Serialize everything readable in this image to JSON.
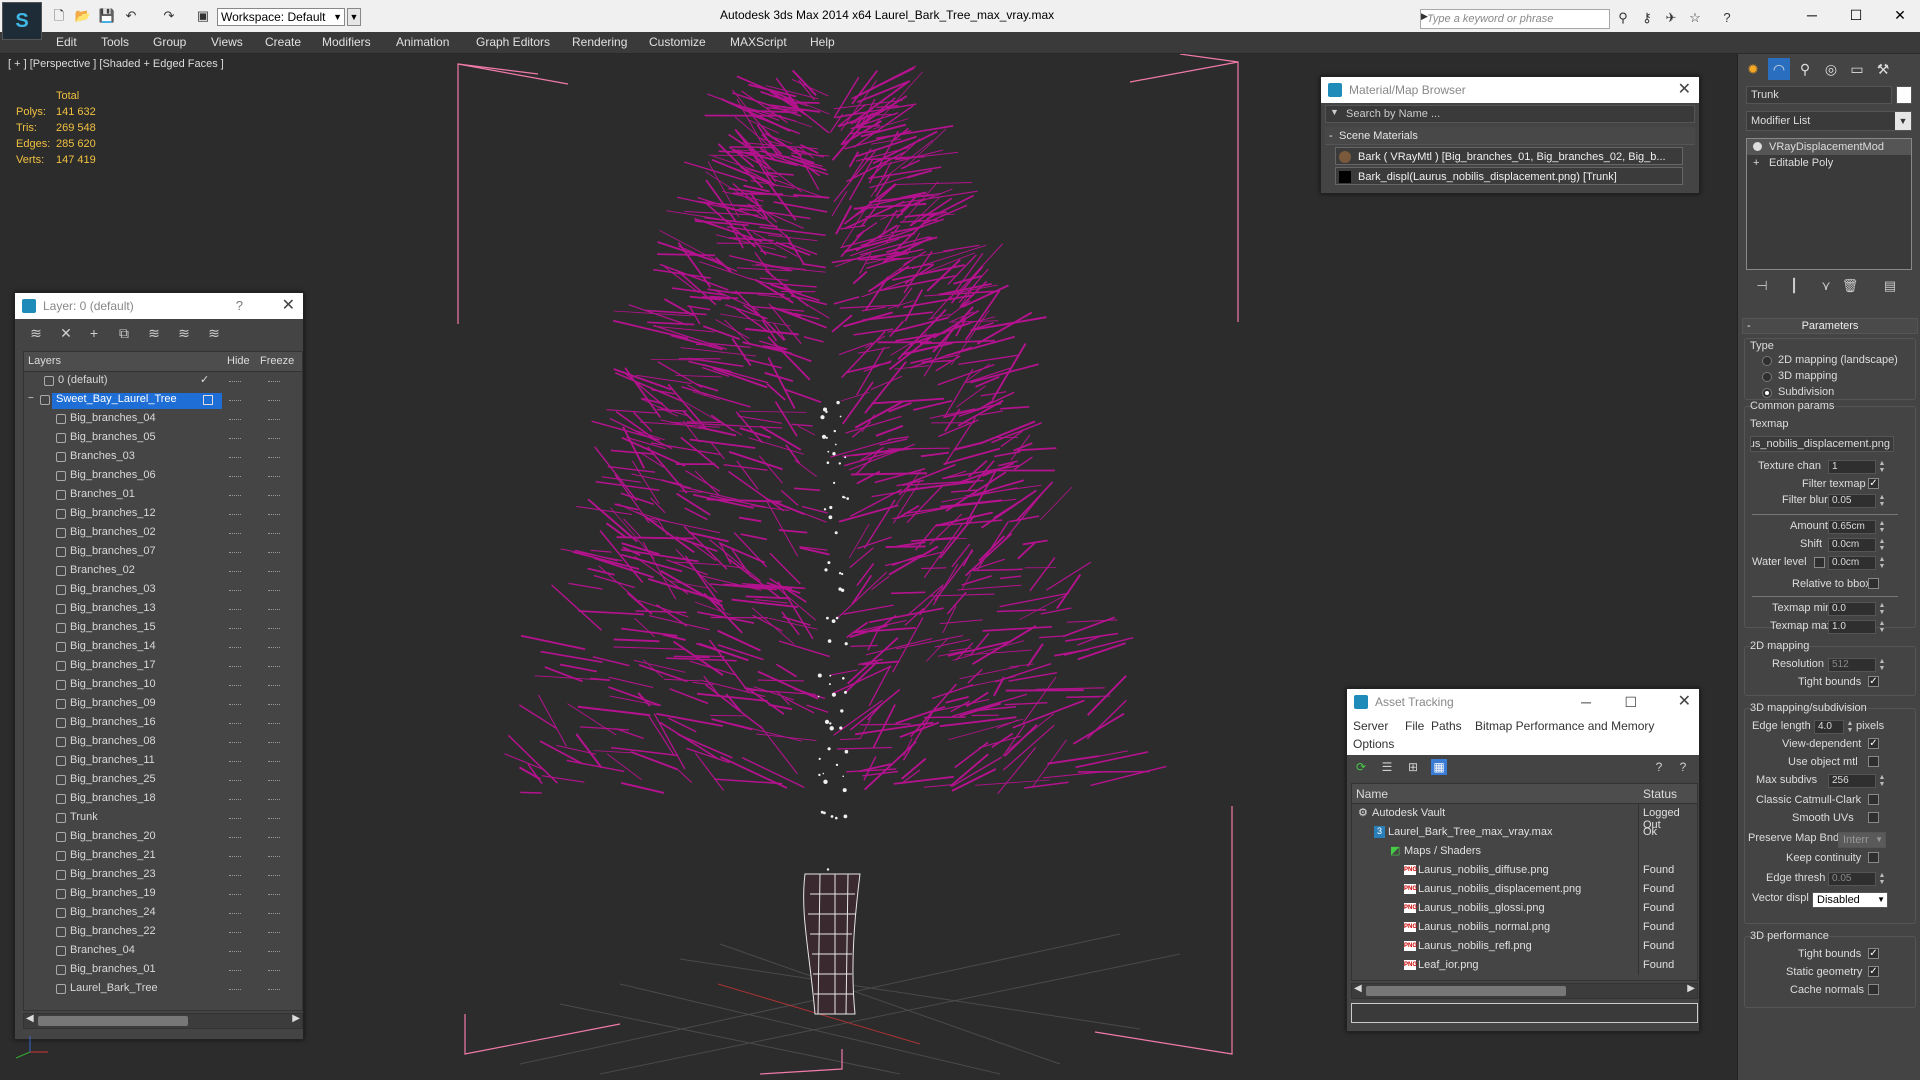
{
  "window": {
    "title": "Autodesk 3ds Max  2014 x64      Laurel_Bark_Tree_max_vray.max",
    "workspace": "Workspace: Default",
    "search_placeholder": "Type a keyword or phrase"
  },
  "menu": [
    "Edit",
    "Tools",
    "Group",
    "Views",
    "Create",
    "Modifiers",
    "Animation",
    "Graph Editors",
    "Rendering",
    "Customize",
    "MAXScript",
    "Help"
  ],
  "viewport": {
    "label": "[ + ] [Perspective ] [Shaded + Edged Faces ]",
    "stats": {
      "header": "Total",
      "rows": [
        {
          "label": "Polys:",
          "value": "141 632"
        },
        {
          "label": "Tris:",
          "value": "269 548"
        },
        {
          "label": "Edges:",
          "value": "285 620"
        },
        {
          "label": "Verts:",
          "value": "147 419"
        }
      ]
    },
    "tree_color": "#b5128f"
  },
  "layer_dialog": {
    "title": "Layer: 0 (default)",
    "help": "?",
    "columns": {
      "layers": "Layers",
      "hide": "Hide",
      "freeze": "Freeze"
    },
    "default_layer": "0 (default)",
    "selected_layer": "Sweet_Bay_Laurel_Tree",
    "children": [
      "Big_branches_04",
      "Big_branches_05",
      "Branches_03",
      "Big_branches_06",
      "Branches_01",
      "Big_branches_12",
      "Big_branches_02",
      "Big_branches_07",
      "Branches_02",
      "Big_branches_03",
      "Big_branches_13",
      "Big_branches_15",
      "Big_branches_14",
      "Big_branches_17",
      "Big_branches_10",
      "Big_branches_09",
      "Big_branches_16",
      "Big_branches_08",
      "Big_branches_11",
      "Big_branches_25",
      "Big_branches_18",
      "Trunk",
      "Big_branches_20",
      "Big_branches_21",
      "Big_branches_23",
      "Big_branches_19",
      "Big_branches_24",
      "Big_branches_22",
      "Branches_04",
      "Big_branches_01",
      "Laurel_Bark_Tree"
    ]
  },
  "material_browser": {
    "title": "Material/Map Browser",
    "search_placeholder": "Search by Name ...",
    "section": "Scene Materials",
    "items": [
      "Bark  ( VRayMtl ) [Big_branches_01, Big_branches_02, Big_b...",
      "Bark_displ(Laurus_nobilis_displacement.png) [Trunk]"
    ]
  },
  "asset_tracking": {
    "title": "Asset Tracking",
    "menu": [
      "Server",
      "File",
      "Paths",
      "Bitmap Performance and Memory",
      "Options"
    ],
    "columns": {
      "name": "Name",
      "status": "Status"
    },
    "rows": [
      {
        "name": "Autodesk Vault",
        "status": "Logged Out"
      },
      {
        "name": "Laurel_Bark_Tree_max_vray.max",
        "status": "Ok"
      },
      {
        "name": "Maps / Shaders",
        "status": ""
      },
      {
        "name": "Laurus_nobilis_diffuse.png",
        "status": "Found"
      },
      {
        "name": "Laurus_nobilis_displacement.png",
        "status": "Found"
      },
      {
        "name": "Laurus_nobilis_glossi.png",
        "status": "Found"
      },
      {
        "name": "Laurus_nobilis_normal.png",
        "status": "Found"
      },
      {
        "name": "Laurus_nobilis_refl.png",
        "status": "Found"
      },
      {
        "name": "Leaf_ior.png",
        "status": "Found"
      }
    ]
  },
  "command_panel": {
    "object_name": "Trunk",
    "modifier_list": "Modifier List",
    "stack": [
      "VRayDisplacementMod",
      "Editable Poly"
    ],
    "parameters": {
      "rollout": "Parameters",
      "type_label": "Type",
      "type_options": [
        "2D mapping (landscape)",
        "3D mapping",
        "Subdivision"
      ],
      "common_label": "Common params",
      "texmap_label": "Texmap",
      "texmap_value": "Laurus_nobilis_displacement.png)",
      "texture_chan_label": "Texture chan",
      "texture_chan": "1",
      "filter_texmap_label": "Filter texmap",
      "filter_blur_label": "Filter blur",
      "filter_blur": "0.05",
      "amount_label": "Amount",
      "amount": "0.65cm",
      "shift_label": "Shift",
      "shift": "0.0cm",
      "water_level_label": "Water level",
      "water_level": "0.0cm",
      "relative_bbox_label": "Relative to bbox",
      "texmap_min_label": "Texmap min",
      "texmap_min": "0.0",
      "texmap_max_label": "Texmap max",
      "texmap_max": "1.0",
      "mapping2d_label": "2D mapping",
      "resolution_label": "Resolution",
      "resolution": "512",
      "tight_bounds_label": "Tight bounds",
      "mapping3d_label": "3D mapping/subdivision",
      "edge_length_label": "Edge length",
      "edge_length": "4.0",
      "pixels_label": "pixels",
      "view_dependent_label": "View-dependent",
      "use_object_mtl_label": "Use object mtl",
      "max_subdivs_label": "Max subdivs",
      "max_subdivs": "256",
      "classic_catmull_label": "Classic Catmull-Clark",
      "smooth_uvs_label": "Smooth UVs",
      "preserve_map_label": "Preserve Map Bnd",
      "preserve_map_value": "Interr",
      "keep_continuity_label": "Keep continuity",
      "edge_thresh_label": "Edge thresh",
      "edge_thresh": "0.05",
      "vector_displ_label": "Vector displ",
      "vector_displ": "Disabled",
      "perf_label": "3D performance",
      "perf_tight_bounds_label": "Tight bounds",
      "static_geometry_label": "Static geometry",
      "cache_normals_label": "Cache normals"
    }
  }
}
